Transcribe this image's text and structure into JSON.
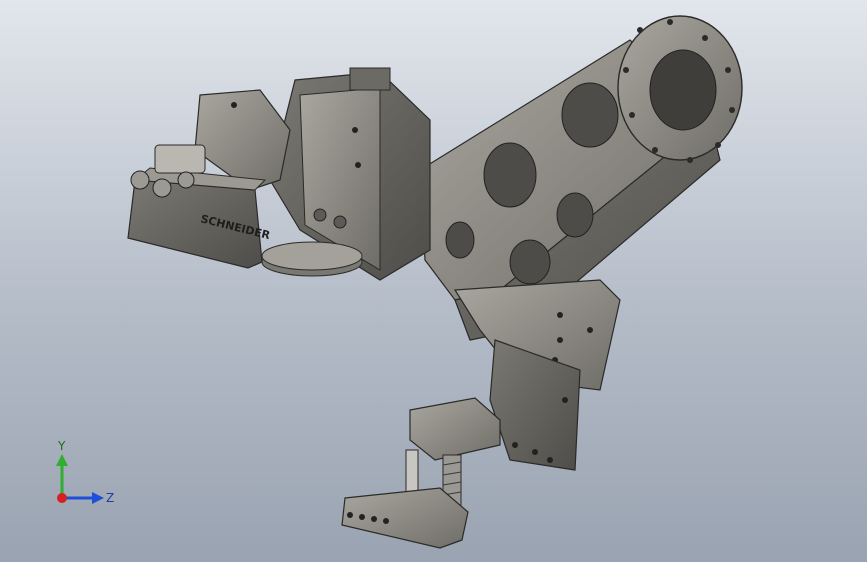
{
  "viewport": {
    "background_top": "#e2e6ec",
    "background_bottom": "#9aa3b1"
  },
  "model": {
    "part_color": "#8c8a84",
    "brand_text": "SCHNEIDER"
  },
  "triad": {
    "x_label": "",
    "y_label": "Y",
    "z_label": "Z",
    "y_color": "#2fae2f",
    "z_color": "#1f4fd8",
    "x_color": "#d42020"
  }
}
